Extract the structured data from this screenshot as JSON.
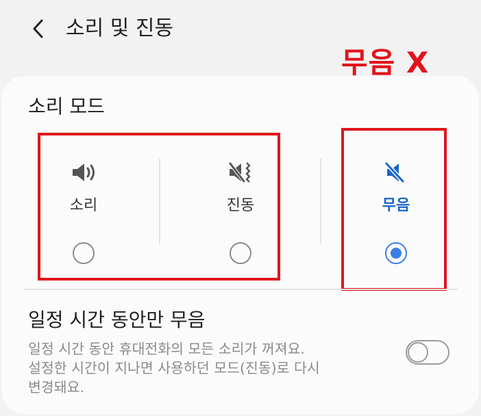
{
  "header": {
    "title": "소리 및 진동",
    "back_icon": "chevron-left-icon"
  },
  "annotation": {
    "text": "무음 X",
    "color": "#e0141c"
  },
  "sound_mode": {
    "title": "소리 모드",
    "options": [
      {
        "label": "소리",
        "icon": "speaker-icon",
        "selected": false
      },
      {
        "label": "진동",
        "icon": "vibrate-icon",
        "selected": false
      },
      {
        "label": "무음",
        "icon": "mute-icon",
        "selected": true
      }
    ]
  },
  "timed_mute": {
    "title": "일정 시간 동안만 무음",
    "description_lines": [
      "일정 시간 동안 휴대전화의 모든 소리가 꺼져요.",
      "설정한 시간이 지나면 사용하던 모드(진동)로 다시",
      "변경돼요."
    ],
    "enabled": false
  },
  "colors": {
    "accent": "#3a7ee8",
    "active_label": "#1a66c4",
    "annotation_red": "#e0141c"
  }
}
